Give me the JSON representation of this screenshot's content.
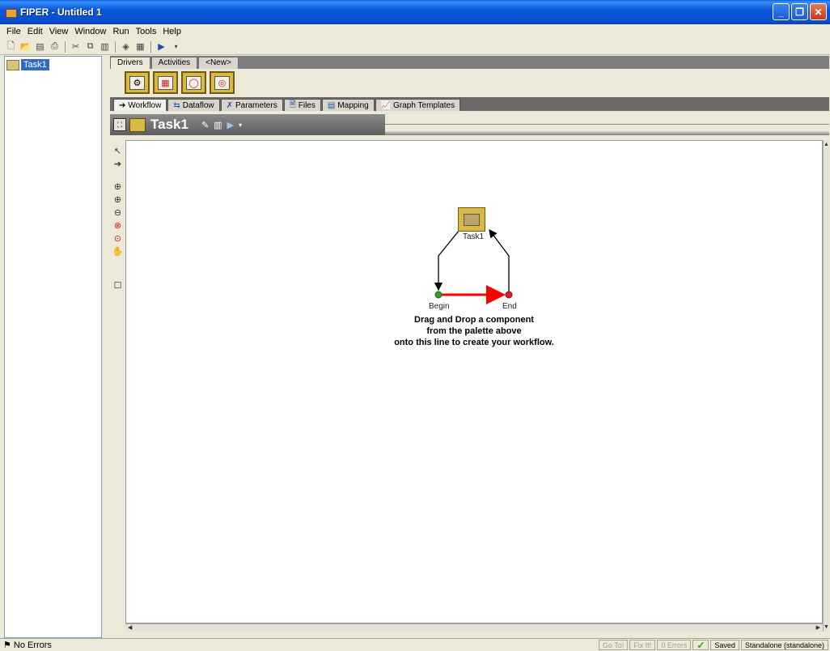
{
  "window": {
    "title": "FIPER - Untitled 1"
  },
  "menu": [
    "File",
    "Edit",
    "View",
    "Window",
    "Run",
    "Tools",
    "Help"
  ],
  "navigator": {
    "items": [
      {
        "label": "Task1"
      }
    ]
  },
  "palette_tabs": [
    "Drivers",
    "Activities",
    "<New>"
  ],
  "view_tabs": [
    "Workflow",
    "Dataflow",
    "Parameters",
    "Files",
    "Mapping",
    "Graph Templates"
  ],
  "task": {
    "title": "Task1"
  },
  "diagram": {
    "task_label": "Task1",
    "begin_label": "Begin",
    "end_label": "End",
    "hint": [
      "Drag and Drop a component",
      "from the palette above",
      "onto this line to create your workflow."
    ],
    "colors": {
      "begin": "#2ea21f",
      "end": "#e01b1b",
      "line": "#ff0000"
    }
  },
  "status": {
    "message": "No Errors",
    "goto": "Go To!",
    "fixit": "Fix It!",
    "errors": "0 Errors",
    "saved": "Saved",
    "mode": "Standalone (standalone)"
  }
}
